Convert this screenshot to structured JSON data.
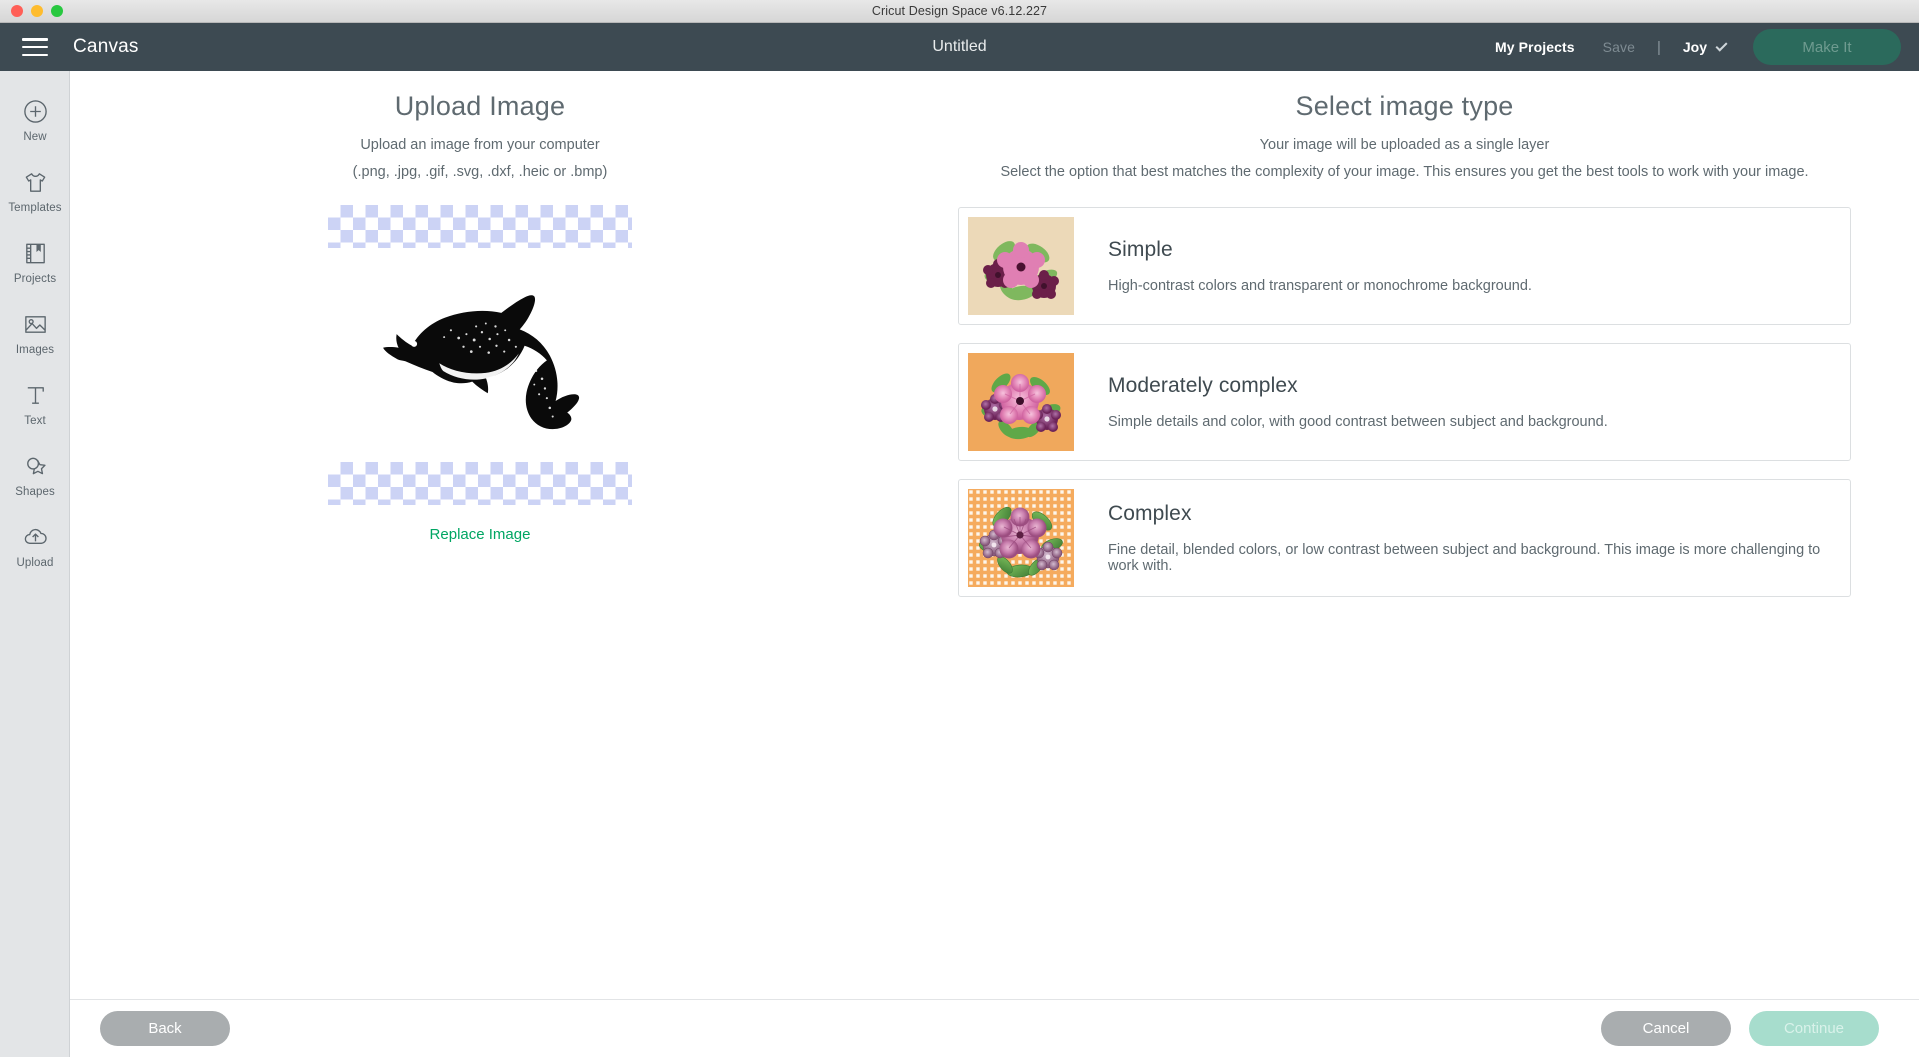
{
  "window": {
    "app_title": "Cricut Design Space",
    "version": "v6.12.227",
    "title_full": "Cricut Design Space  v6.12.227"
  },
  "header": {
    "menu_icon": "hamburger-icon",
    "canvas_label": "Canvas",
    "document_title": "Untitled",
    "my_projects": "My Projects",
    "save": "Save",
    "separator": "|",
    "machine": "Joy",
    "machine_chevron": "chevron-down-icon",
    "make_it": "Make It",
    "bg_color": "#3d4a52",
    "make_it_color": "#2b6a5c"
  },
  "sidebar": {
    "items": [
      {
        "label": "New",
        "icon": "plus-circle-icon"
      },
      {
        "label": "Templates",
        "icon": "tshirt-icon"
      },
      {
        "label": "Projects",
        "icon": "book-bookmark-icon"
      },
      {
        "label": "Images",
        "icon": "picture-icon"
      },
      {
        "label": "Text",
        "icon": "text-t-icon"
      },
      {
        "label": "Shapes",
        "icon": "star-shape-icon"
      },
      {
        "label": "Upload",
        "icon": "cloud-upload-icon"
      }
    ]
  },
  "upload_panel": {
    "heading": "Upload Image",
    "subtitle": "Upload an image from your computer",
    "file_types": "(.png, .jpg, .gif, .svg, .dxf, .heic or .bmp)",
    "preview_alt": "dolphin-silhouette",
    "replace_link": "Replace Image",
    "link_color": "#00a663",
    "checker_color": "#ccd3f5"
  },
  "type_panel": {
    "heading": "Select image type",
    "subtitle": "Your image will be uploaded as a single layer",
    "description": "Select the option that best matches the complexity of your image. This ensures you get the best tools to work with your image.",
    "options": [
      {
        "title": "Simple",
        "description": "High-contrast colors and transparent or monochrome background.",
        "thumb_bg": "#ecd9b8",
        "thumb_style": "flat-flowers"
      },
      {
        "title": "Moderately complex",
        "description": "Simple details and color, with good contrast between subject and background.",
        "thumb_bg": "#f0a85c",
        "thumb_style": "shaded-flowers"
      },
      {
        "title": "Complex",
        "description": "Fine detail, blended colors, or low contrast between subject and background. This image is more challenging to work with.",
        "thumb_bg": "#f5ab5e",
        "thumb_style": "dotted-flowers"
      }
    ]
  },
  "footer": {
    "back": "Back",
    "cancel": "Cancel",
    "continue": "Continue"
  }
}
